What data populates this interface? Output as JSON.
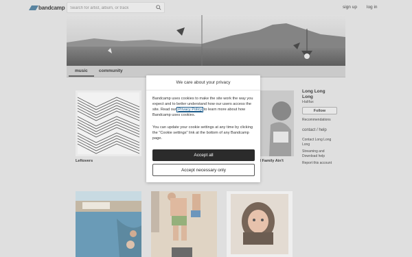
{
  "header": {
    "logo_text": "bandcamp",
    "search_placeholder": "Search for artist, album, or track",
    "signup_label": "sign up",
    "login_label": "log in"
  },
  "nav": {
    "tabs": [
      {
        "label": "music",
        "active": true
      },
      {
        "label": "community",
        "active": false
      }
    ]
  },
  "albums": [
    {
      "title": "Leftovers"
    },
    {
      "title": "aid Family Ain't"
    }
  ],
  "sidebar": {
    "artist_name": "Long Long Long",
    "location": "Halifax",
    "follow_label": "Follow",
    "recommendations_label": "Recommendations",
    "contact_heading": "contact / help",
    "contact_link": "Contact Long Long Long",
    "streaming_link": "Streaming and Download help",
    "report_link": "Report this account"
  },
  "privacy_modal": {
    "title": "We care about your privacy",
    "paragraph1_before": "Bandcamp uses cookies to make the site work the way you expect and to better understand how our users access the site. Read our ",
    "paragraph1_link": "Privacy Policy",
    "paragraph1_after": " to learn more about how Bandcamp uses cookies.",
    "paragraph2": "You can update your cookie settings at any time by clicking the \"Cookie settings\" link at the bottom of any Bandcamp page.",
    "accept_all_label": "Accept all",
    "accept_necessary_label": "Accept necessary only"
  },
  "colors": {
    "brand_accent": "#356a8c",
    "primary_button": "#2b2b2b"
  }
}
